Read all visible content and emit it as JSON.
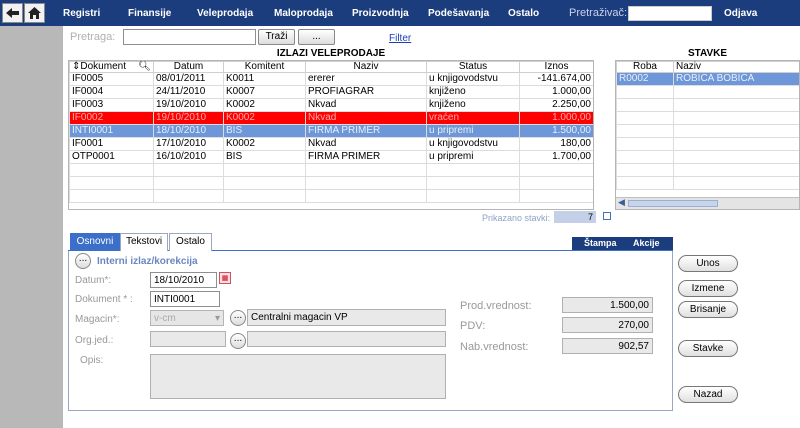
{
  "nav": {
    "items": [
      "Registri",
      "Finansije",
      "Veleprodaja",
      "Maloprodaja",
      "Proizvodnja",
      "Podešavanja",
      "Ostalo"
    ],
    "search_label": "Pretraživač:",
    "search_value": "",
    "logout": "Odjava"
  },
  "search": {
    "label": "Pretraga:",
    "value": "",
    "button": "Traži",
    "more": "...",
    "filter": "Filter"
  },
  "grid": {
    "title": "IZLAZI VELEPRODAJE",
    "columns": [
      "Dokument",
      "Datum",
      "Komitent",
      "Naziv",
      "Status",
      "Iznos"
    ],
    "rows": [
      {
        "dokument": "IF0005",
        "datum": "08/01/2011",
        "komitent": "K0011",
        "naziv": "ererer",
        "status": "u knjigovodstvu",
        "iznos": "-141.674,00",
        "state": "normal"
      },
      {
        "dokument": "IF0004",
        "datum": "24/11/2010",
        "komitent": "K0007",
        "naziv": "PROFIAGRAR",
        "status": "knjiženo",
        "iznos": "1.000,00",
        "state": "normal"
      },
      {
        "dokument": "IF0003",
        "datum": "19/10/2010",
        "komitent": "K0002",
        "naziv": "Nkvad",
        "status": "knjiženo",
        "iznos": "2.250,00",
        "state": "normal"
      },
      {
        "dokument": "IF0002",
        "datum": "19/10/2010",
        "komitent": "K0002",
        "naziv": "Nkvad",
        "status": "vraćen",
        "iznos": "1.000,00",
        "state": "red"
      },
      {
        "dokument": "INTI0001",
        "datum": "18/10/2010",
        "komitent": "BIS",
        "naziv": "FIRMA PRIMER",
        "status": "u pripremi",
        "iznos": "1.500,00",
        "state": "selected"
      },
      {
        "dokument": "IF0001",
        "datum": "17/10/2010",
        "komitent": "K0002",
        "naziv": "Nkvad",
        "status": "u knjigovodstvu",
        "iznos": "180,00",
        "state": "normal"
      },
      {
        "dokument": "OTP0001",
        "datum": "16/10/2010",
        "komitent": "BIS",
        "naziv": "FIRMA PRIMER",
        "status": "u pripremi",
        "iznos": "1.700,00",
        "state": "normal"
      }
    ],
    "shown_label": "Prikazano stavki:",
    "shown_count": "7"
  },
  "stavke": {
    "title": "STAVKE",
    "columns": [
      "Roba",
      "Naziv"
    ],
    "rows": [
      {
        "roba": "R0002",
        "naziv": "ROBICA BOBICA"
      }
    ]
  },
  "tabs": [
    "Osnovni",
    "Tekstovi",
    "Ostalo"
  ],
  "actions": [
    "Štampa",
    "Akcije"
  ],
  "form": {
    "title": "Interni izlaz/korekcija",
    "datum_label": "Datum*:",
    "datum_value": "18/10/2010",
    "dokument_label": "Dokument * :",
    "dokument_value": "INTI0001",
    "magacin_label": "Magacin*:",
    "magacin_value": "v-cm",
    "magacin_name": "Centralni magacin VP",
    "orgjed_label": "Org.jed.:",
    "orgjed_value": "",
    "orgjed_name": "",
    "opis_label": "Opis:",
    "opis_value": "",
    "prod_label": "Prod.vrednost:",
    "prod_value": "1.500,00",
    "pdv_label": "PDV:",
    "pdv_value": "270,00",
    "nab_label": "Nab.vrednost:",
    "nab_value": "902,57"
  },
  "side_buttons": [
    "Unos",
    "Izmene",
    "Brisanje",
    "Stavke",
    "Nazad"
  ],
  "colors": {
    "nav": "#1b3d7e",
    "selected": "#6d97d8",
    "error_row": "#ff0000",
    "tab_active": "#3b6fc9"
  }
}
